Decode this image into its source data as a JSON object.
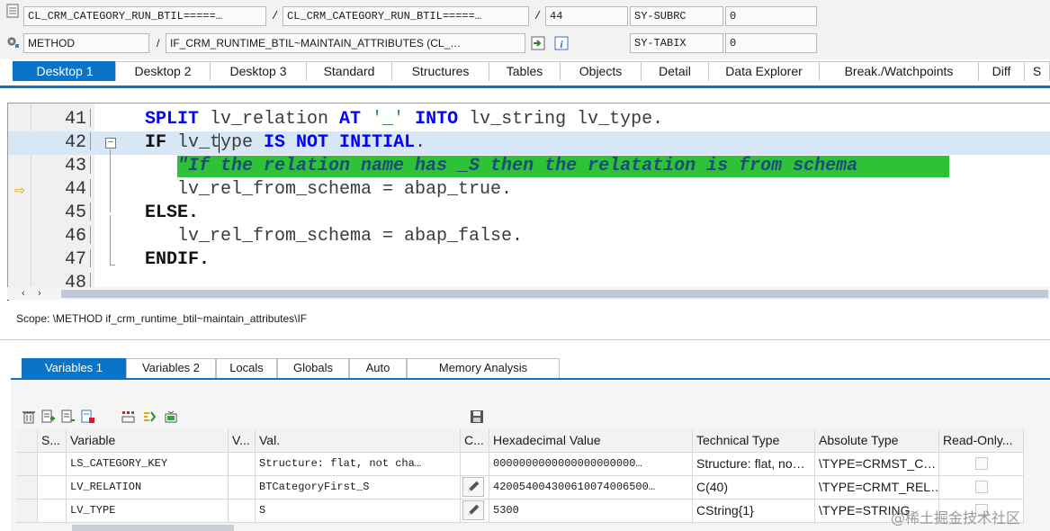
{
  "header": {
    "program": "CL_CRM_CATEGORY_RUN_BTIL=====…",
    "include": "CL_CRM_CATEGORY_RUN_BTIL=====…",
    "line": "44",
    "subrc_label": "SY-SUBRC",
    "subrc_value": "0",
    "event_type": "METHOD",
    "event": "IF_CRM_RUNTIME_BTIL~MAINTAIN_ATTRIBUTES (CL_…",
    "tabix_label": "SY-TABIX",
    "tabix_value": "0",
    "slash": "/"
  },
  "desktop_tabs": [
    "Desktop 1",
    "Desktop 2",
    "Desktop 3",
    "Standard",
    "Structures",
    "Tables",
    "Objects",
    "Detail",
    "Data Explorer",
    "Break./Watchpoints",
    "Diff",
    "S"
  ],
  "editor": {
    "lines": [
      {
        "num": "41"
      },
      {
        "num": "42"
      },
      {
        "num": "43"
      },
      {
        "num": "44"
      },
      {
        "num": "45"
      },
      {
        "num": "46"
      },
      {
        "num": "47"
      },
      {
        "num": "48"
      }
    ],
    "code": {
      "l41_kw1": "SPLIT",
      "l41_a": " lv_relation ",
      "l41_kw2": "AT",
      "l41_str": " '_' ",
      "l41_kw3": "INTO",
      "l41_b": " lv_string lv_type.",
      "l42_kw1": "IF",
      "l42_a": " lv_type ",
      "l42_kw2": "IS NOT INITIAL",
      "l42_b": ".",
      "l43_comment": "\"If the relation name has _S then the relatation is from schema",
      "l44": "lv_rel_from_schema = abap_true.",
      "l45": "ELSE.",
      "l46": "lv_rel_from_schema = abap_false.",
      "l47": "ENDIF."
    }
  },
  "scope_text": "Scope: \\METHOD if_crm_runtime_btil~maintain_attributes\\IF",
  "variable_tabs": [
    "Variables 1",
    "Variables 2",
    "Locals",
    "Globals",
    "Auto",
    "Memory Analysis"
  ],
  "grid": {
    "headers": [
      "S...",
      "Variable",
      "V...",
      "Val.",
      "C...",
      "Hexadecimal Value",
      "Technical Type",
      "Absolute Type",
      "Read-Only..."
    ],
    "rows": [
      {
        "variable": "LS_CATEGORY_KEY",
        "value": "Structure: flat, not cha…",
        "hex": "0000000000000000000000…",
        "tech": "Structure: flat, no…",
        "abs": "\\TYPE=CRMST_C…"
      },
      {
        "variable": "LV_RELATION",
        "value": "BTCategoryFirst_S",
        "hex": "420054004300610074006500…",
        "tech": "C(40)",
        "abs": "\\TYPE=CRMT_REL…"
      },
      {
        "variable": "LV_TYPE",
        "value": "S",
        "hex": "5300",
        "tech": "CString{1}",
        "abs": "\\TYPE=STRING"
      }
    ]
  },
  "watermark": "@稀土掘金技术社区",
  "colors": {
    "accent": "#0a74c9",
    "comment_bg": "#2ec236",
    "keyword": "#0000ff",
    "current_line": "#d8e7f6"
  }
}
